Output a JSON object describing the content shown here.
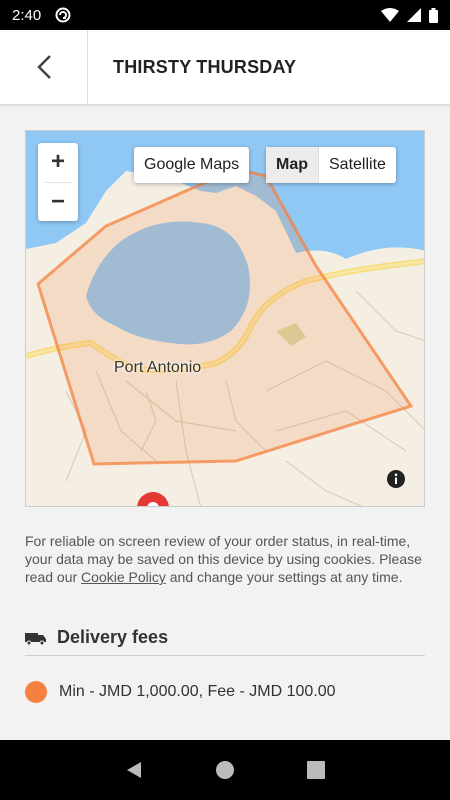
{
  "status_bar": {
    "time": "2:40"
  },
  "header": {
    "title": "THIRSTY THURSDAY"
  },
  "map": {
    "city_label": "Port Antonio",
    "google_maps_label": "Google Maps",
    "map_type_map": "Map",
    "map_type_satellite": "Satellite",
    "zoom_in": "+",
    "zoom_out": "−",
    "zone_color": "#f4813f"
  },
  "notice": {
    "text_before": "For reliable on screen review of your order status, in real-time, your data may be saved on this device by using cookies. Please read our ",
    "link": "Cookie Policy",
    "text_after": " and change your settings at any time."
  },
  "delivery_fees": {
    "heading": "Delivery fees",
    "rows": [
      {
        "text": "Min - JMD 1,000.00, Fee - JMD 100.00",
        "color": "#f4813f"
      }
    ]
  }
}
